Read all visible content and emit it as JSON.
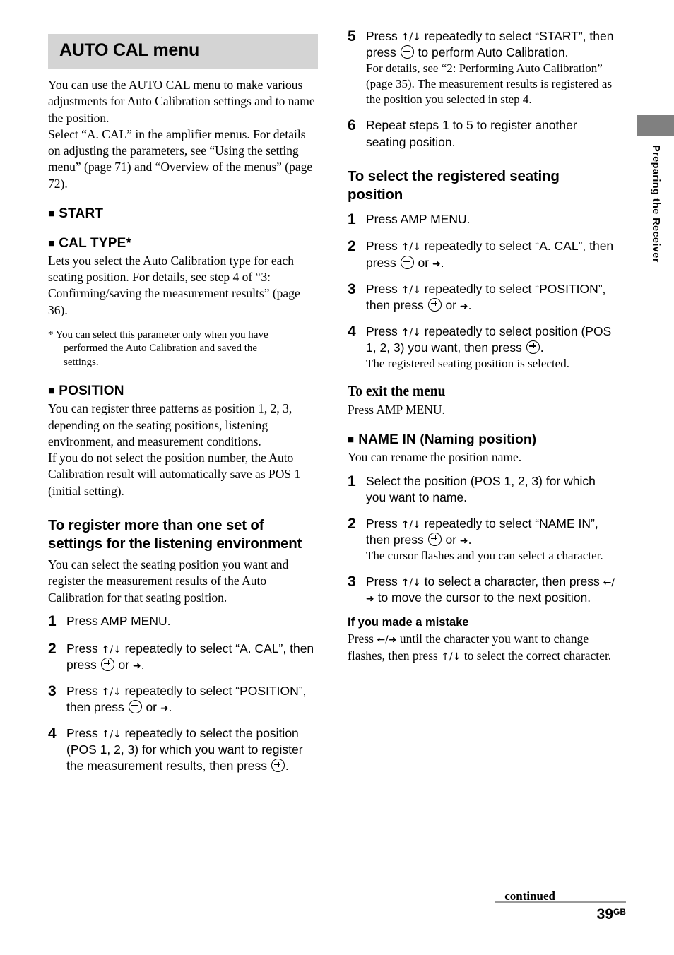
{
  "page": {
    "number": "39",
    "region_suffix": "GB",
    "continued_label": "continued",
    "side_tab_label": "Preparing the Receiver"
  },
  "left": {
    "banner_title": "AUTO CAL menu",
    "intro1": "You can use the AUTO CAL menu to make various adjustments for Auto Calibration settings and to name the position.",
    "intro2": "Select “A. CAL” in the amplifier menus. For details on adjusting the parameters, see “Using the setting menu” (page 71) and “Overview of the menus” (page 72).",
    "h_start": "START",
    "h_caltype": "CAL TYPE",
    "h_caltype_asterisk": "*",
    "caltype_body": "Lets you select the Auto Calibration type for each seating position. For details, see step 4 of “3: Confirming/saving the measurement results” (page 36).",
    "footnote_marker": "*",
    "footnote_line1": "You can select this parameter only when you have",
    "footnote_line2": "performed the Auto Calibration and saved the",
    "footnote_line3": "settings.",
    "h_position": "POSITION",
    "position_body1": "You can register three patterns as position 1, 2, 3, depending on the seating positions, listening environment, and measurement conditions.",
    "position_body2": "If you do not select the position number, the Auto Calibration result will automatically save as POS 1 (initial setting).",
    "h_register": "To register more than one set of settings for the listening environment",
    "register_body": "You can select the seating position you want and register the measurement results of the Auto Calibration for that seating position.",
    "steps": [
      {
        "num": "1",
        "parts": [
          {
            "t": "text",
            "v": "Press AMP MENU."
          }
        ]
      },
      {
        "num": "2",
        "parts": [
          {
            "t": "text",
            "v": "Press "
          },
          {
            "t": "arrows",
            "v": "↑/↓"
          },
          {
            "t": "text",
            "v": " repeatedly to select “A. CAL”, then press "
          },
          {
            "t": "enter"
          },
          {
            "t": "text",
            "v": " or "
          },
          {
            "t": "arrow-r",
            "v": "➜"
          },
          {
            "t": "text",
            "v": "."
          }
        ]
      },
      {
        "num": "3",
        "parts": [
          {
            "t": "text",
            "v": "Press "
          },
          {
            "t": "arrows",
            "v": "↑/↓"
          },
          {
            "t": "text",
            "v": " repeatedly to select “POSITION”, then press "
          },
          {
            "t": "enter"
          },
          {
            "t": "text",
            "v": " or "
          },
          {
            "t": "arrow-r",
            "v": "➜"
          },
          {
            "t": "text",
            "v": "."
          }
        ]
      },
      {
        "num": "4",
        "parts": [
          {
            "t": "text",
            "v": "Press "
          },
          {
            "t": "arrows",
            "v": "↑/↓"
          },
          {
            "t": "text",
            "v": " repeatedly to select the position (POS 1, 2, 3) for which you want to register the measurement results, then press "
          },
          {
            "t": "enter"
          },
          {
            "t": "text",
            "v": "."
          }
        ]
      }
    ]
  },
  "right": {
    "steps_top": [
      {
        "num": "5",
        "parts": [
          {
            "t": "text",
            "v": "Press "
          },
          {
            "t": "arrows",
            "v": "↑/↓"
          },
          {
            "t": "text",
            "v": " repeatedly to select “START”, then press "
          },
          {
            "t": "enter"
          },
          {
            "t": "text",
            "v": " to perform Auto Calibration."
          }
        ],
        "sub": "For details, see “2: Performing Auto Calibration” (page 35). The measurement results is registered as the position you selected in step 4."
      },
      {
        "num": "6",
        "parts": [
          {
            "t": "text",
            "v": "Repeat steps 1 to 5 to register another seating position."
          }
        ]
      }
    ],
    "h_select_registered": "To select the registered seating position",
    "steps_select": [
      {
        "num": "1",
        "parts": [
          {
            "t": "text",
            "v": "Press AMP MENU."
          }
        ]
      },
      {
        "num": "2",
        "parts": [
          {
            "t": "text",
            "v": "Press "
          },
          {
            "t": "arrows",
            "v": "↑/↓"
          },
          {
            "t": "text",
            "v": " repeatedly to select “A. CAL”, then press "
          },
          {
            "t": "enter"
          },
          {
            "t": "text",
            "v": " or "
          },
          {
            "t": "arrow-r",
            "v": "➜"
          },
          {
            "t": "text",
            "v": "."
          }
        ]
      },
      {
        "num": "3",
        "parts": [
          {
            "t": "text",
            "v": "Press "
          },
          {
            "t": "arrows",
            "v": "↑/↓"
          },
          {
            "t": "text",
            "v": " repeatedly to select “POSITION”, then press "
          },
          {
            "t": "enter"
          },
          {
            "t": "text",
            "v": " or "
          },
          {
            "t": "arrow-r",
            "v": "➜"
          },
          {
            "t": "text",
            "v": "."
          }
        ]
      },
      {
        "num": "4",
        "parts": [
          {
            "t": "text",
            "v": "Press "
          },
          {
            "t": "arrows",
            "v": "↑/↓"
          },
          {
            "t": "text",
            "v": " repeatedly to select position (POS 1, 2, 3) you want, then press "
          },
          {
            "t": "enter"
          },
          {
            "t": "text",
            "v": "."
          }
        ],
        "sub": "The registered seating position is selected."
      }
    ],
    "h_exit": "To exit the menu",
    "exit_body": "Press AMP MENU.",
    "h_namein": "NAME IN (Naming position)",
    "namein_body": "You can rename the position name.",
    "steps_namein": [
      {
        "num": "1",
        "parts": [
          {
            "t": "text",
            "v": "Select the position (POS 1, 2, 3) for which you want to name."
          }
        ]
      },
      {
        "num": "2",
        "parts": [
          {
            "t": "text",
            "v": "Press "
          },
          {
            "t": "arrows",
            "v": "↑/↓"
          },
          {
            "t": "text",
            "v": " repeatedly to select “NAME IN”, then press "
          },
          {
            "t": "enter"
          },
          {
            "t": "text",
            "v": " or "
          },
          {
            "t": "arrow-r",
            "v": "➜"
          },
          {
            "t": "text",
            "v": "."
          }
        ],
        "sub": "The cursor flashes and you can select a character."
      },
      {
        "num": "3",
        "parts": [
          {
            "t": "text",
            "v": "Press "
          },
          {
            "t": "arrows",
            "v": "↑/↓"
          },
          {
            "t": "text",
            "v": " to select a character, then press "
          },
          {
            "t": "arrows",
            "v": "←/➜"
          },
          {
            "t": "text",
            "v": " to move the cursor to the next position."
          }
        ]
      }
    ],
    "h_mistake": "If you made a mistake",
    "mistake_parts": [
      {
        "t": "text",
        "v": "Press "
      },
      {
        "t": "arrows",
        "v": "←/➜"
      },
      {
        "t": "text",
        "v": " until the character you want to change flashes, then press "
      },
      {
        "t": "arrows",
        "v": "↑/↓"
      },
      {
        "t": "text",
        "v": " to select the correct character."
      }
    ]
  }
}
